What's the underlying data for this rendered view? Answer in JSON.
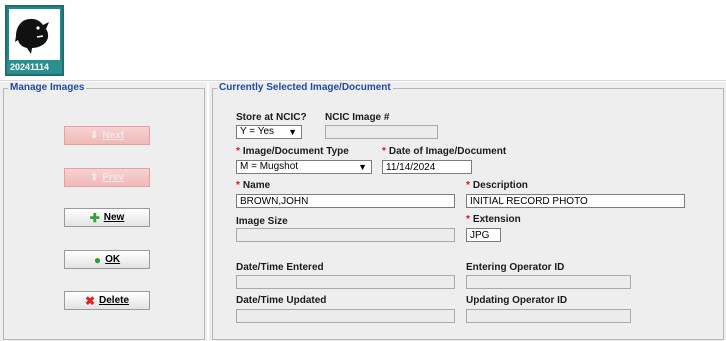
{
  "thumbnail": {
    "label": "20241114",
    "icon": "shark-logo"
  },
  "manage_images": {
    "legend": "Manage Images",
    "buttons": [
      {
        "label": "Next",
        "icon": "arrow-down-icon",
        "enabled": false
      },
      {
        "label": "Prev",
        "icon": "arrow-up-icon",
        "enabled": false
      },
      {
        "label": "New",
        "icon": "plus-icon",
        "enabled": true
      },
      {
        "label": "OK",
        "icon": "check-icon",
        "enabled": true
      },
      {
        "label": "Delete",
        "icon": "x-icon",
        "enabled": true
      }
    ]
  },
  "current": {
    "legend": "Currently Selected Image/Document",
    "store_at_ncic": {
      "label": "Store at NCIC?",
      "value": "Y = Yes"
    },
    "ncic_image": {
      "label": "NCIC Image #",
      "value": ""
    },
    "image_type": {
      "label": "Image/Document Type",
      "value": "M = Mugshot"
    },
    "date_image": {
      "label": "Date of Image/Document",
      "value": "11/14/2024"
    },
    "name": {
      "label": "Name",
      "value": "BROWN,JOHN"
    },
    "description": {
      "label": "Description",
      "value": "INITIAL RECORD PHOTO"
    },
    "image_size": {
      "label": "Image Size",
      "value": ""
    },
    "extension": {
      "label": "Extension",
      "value": "JPG"
    },
    "dt_entered": {
      "label": "Date/Time Entered",
      "value": ""
    },
    "entering_operator": {
      "label": "Entering Operator ID",
      "value": ""
    },
    "dt_updated": {
      "label": "Date/Time Updated",
      "value": ""
    },
    "updating_operator": {
      "label": "Updating Operator ID",
      "value": ""
    }
  }
}
